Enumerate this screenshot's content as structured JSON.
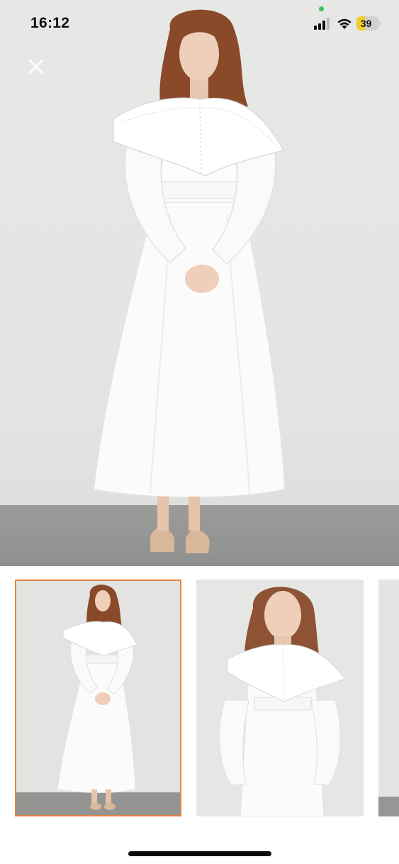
{
  "status_bar": {
    "time": "16:12",
    "battery_percent": 39,
    "battery_label": "39",
    "battery_color": "#f2cd2a",
    "signal_bars_active": 3,
    "signal_bars_total": 4,
    "privacy_indicator_color": "#35c759",
    "icons": [
      "cellular-signal-icon",
      "wifi-icon",
      "battery-icon"
    ]
  },
  "viewer": {
    "close_icon": "close-icon",
    "main_image": "white-dress-full-length-photo",
    "thumbnails": [
      {
        "image": "white-dress-full-length-photo",
        "selected": true
      },
      {
        "image": "white-dress-upper-body-photo",
        "selected": false
      },
      {
        "image": "white-dress-partial-photo",
        "selected": false
      }
    ],
    "selected_border_color": "#e8843d"
  }
}
